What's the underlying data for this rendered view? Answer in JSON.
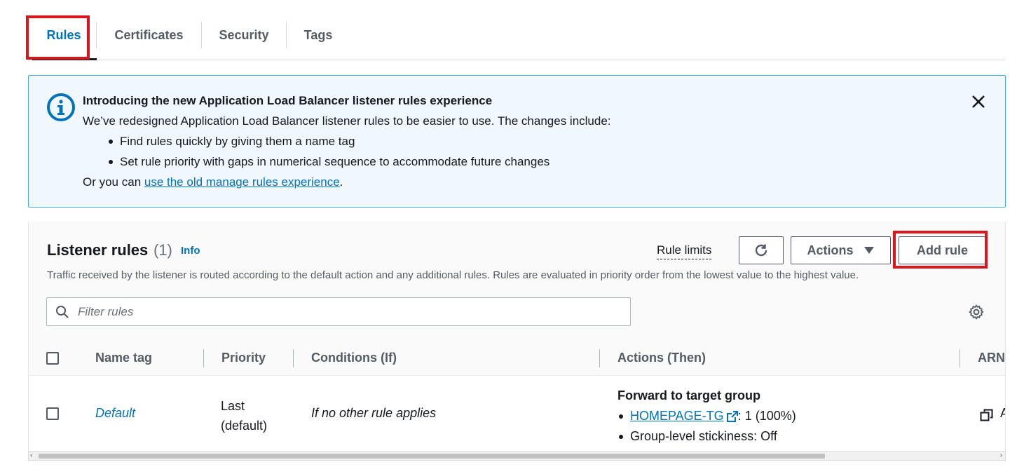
{
  "tabs": [
    {
      "label": "Rules",
      "active": true
    },
    {
      "label": "Certificates",
      "active": false
    },
    {
      "label": "Security",
      "active": false
    },
    {
      "label": "Tags",
      "active": false
    }
  ],
  "banner": {
    "title": "Introducing the new Application Load Balancer listener rules experience",
    "intro": "We’ve redesigned Application Load Balancer listener rules to be easier to use. The changes include:",
    "bullets": [
      "Find rules quickly by giving them a name tag",
      "Set rule priority with gaps in numerical sequence to accommodate future changes"
    ],
    "footer_prefix": "Or you can ",
    "footer_link": "use the old manage rules experience",
    "footer_suffix": ".",
    "icon": "info-icon",
    "close_icon": "close-icon"
  },
  "listener_rules": {
    "title": "Listener rules",
    "count": "(1)",
    "info_label": "Info",
    "rule_limits_label": "Rule limits",
    "refresh_icon": "refresh-icon",
    "actions_label": "Actions",
    "add_rule_label": "Add rule",
    "description": "Traffic received by the listener is routed according to the default action and any additional rules. Rules are evaluated in priority order from the lowest value to the highest value.",
    "filter_placeholder": "Filter rules",
    "columns": [
      "Name tag",
      "Priority",
      "Conditions (If)",
      "Actions (Then)",
      "ARN"
    ],
    "rows": [
      {
        "name_tag": "Default",
        "priority_line1": "Last",
        "priority_line2": "(default)",
        "conditions": "If no other rule applies",
        "action_title": "Forward to target group",
        "target_group": "HOMEPAGE-TG",
        "target_weight": ": 1 (100%)",
        "stickiness": "Group-level stickiness: Off",
        "arn_partial": "A"
      }
    ]
  },
  "colors": {
    "accent": "#0073bb",
    "highlight_box": "#d9161b",
    "banner_bg": "#f0f8fd",
    "banner_border": "#47a8e6"
  }
}
